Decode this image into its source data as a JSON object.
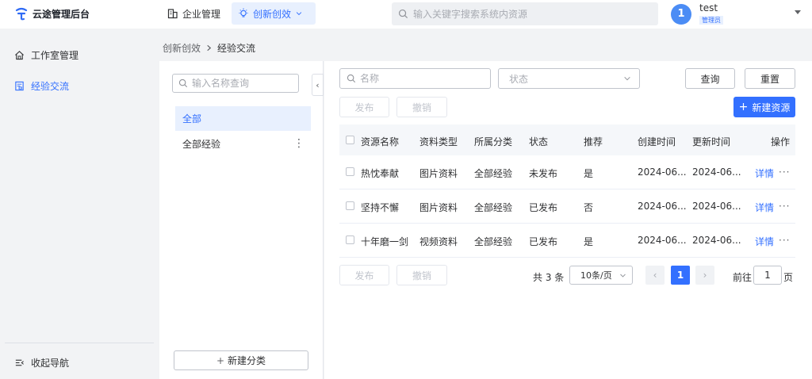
{
  "app": {
    "title": "云途管理后台"
  },
  "topnav": {
    "items": [
      {
        "label": "企业管理",
        "icon": "building-icon"
      },
      {
        "label": "创新创效",
        "icon": "lightbulb-icon"
      }
    ],
    "search_placeholder": "输入关键字搜索系统内资源"
  },
  "user": {
    "avatar": "1",
    "name": "test",
    "role": "管理员"
  },
  "sidebar": {
    "items": [
      {
        "label": "工作室管理",
        "icon": "home-icon"
      },
      {
        "label": "经验交流",
        "icon": "document-icon"
      }
    ],
    "collapse_label": "收起导航"
  },
  "breadcrumb": {
    "parent": "创新创效",
    "current": "经验交流"
  },
  "categories": {
    "search_placeholder": "输入名称查询",
    "items": [
      {
        "label": "全部"
      },
      {
        "label": "全部经验"
      }
    ],
    "new_button": "新建分类"
  },
  "filters": {
    "name_placeholder": "名称",
    "status_placeholder": "状态",
    "query_button": "查询",
    "reset_button": "重置"
  },
  "actions": {
    "publish": "发布",
    "revoke": "撤销",
    "new_resource": "新建资源"
  },
  "table": {
    "headers": [
      "资源名称",
      "资料类型",
      "所属分类",
      "状态",
      "推荐",
      "创建时间",
      "更新时间",
      "操作"
    ],
    "rows": [
      {
        "name": "热忱奉献",
        "type": "图片资料",
        "category": "全部经验",
        "status": "未发布",
        "recommend": "是",
        "created": "2024-06...",
        "updated": "2024-06...",
        "action": "详情"
      },
      {
        "name": "坚持不懈",
        "type": "图片资料",
        "category": "全部经验",
        "status": "已发布",
        "recommend": "否",
        "created": "2024-06...",
        "updated": "2024-06...",
        "action": "详情"
      },
      {
        "name": "十年磨一剑",
        "type": "视频资料",
        "category": "全部经验",
        "status": "已发布",
        "recommend": "是",
        "created": "2024-06...",
        "updated": "2024-06...",
        "action": "详情"
      }
    ]
  },
  "pagination": {
    "total": "共 3 条",
    "page_size": "10条/页",
    "current_page": "1",
    "goto_prefix": "前往",
    "goto_value": "1",
    "goto_suffix": "页"
  },
  "colors": {
    "accent": "#3370ff",
    "accent_light": "#e8f0fe",
    "avatar": "#4b8cf5"
  }
}
